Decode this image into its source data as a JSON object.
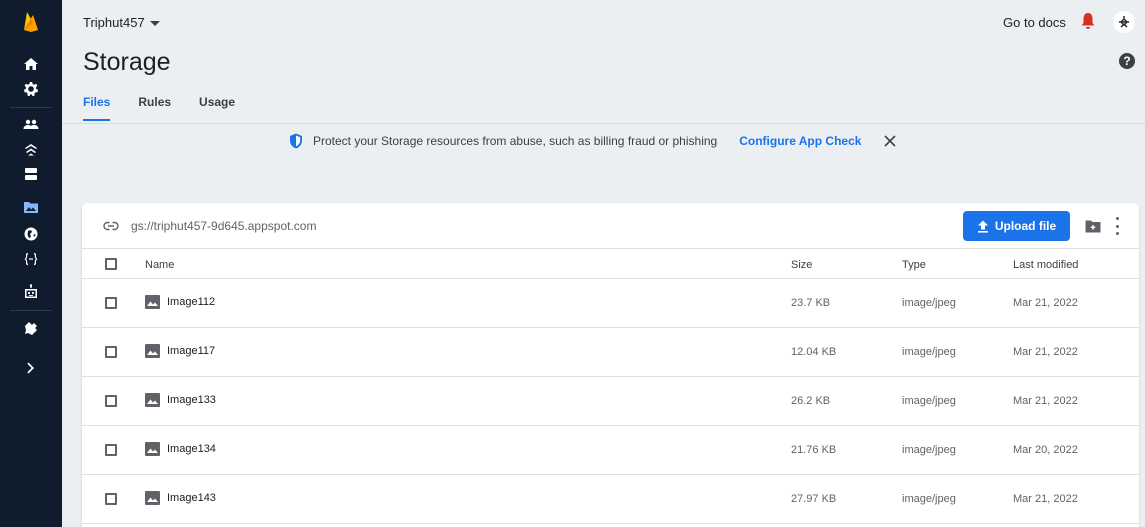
{
  "colors": {
    "rail_bg": "#0f1c2e",
    "accent": "#1a73e8",
    "page_bg": "#eceff1",
    "firebase_orange": "#ffa000",
    "bell_red": "#d93025"
  },
  "rail": {
    "icons": [
      "firebase-logo-icon",
      "home-icon",
      "gear-icon",
      "people-icon",
      "cloud-signal-icon",
      "database-icon",
      "storage-folder-icon",
      "globe-icon",
      "functions-icon",
      "robot-icon",
      "extensions-icon",
      "chevron-right-icon"
    ],
    "active": "storage-folder-icon"
  },
  "topbar": {
    "project_name": "Triphut457",
    "docs_link": "Go to docs"
  },
  "page": {
    "title": "Storage"
  },
  "tabs": [
    {
      "label": "Files",
      "active": true
    },
    {
      "label": "Rules",
      "active": false
    },
    {
      "label": "Usage",
      "active": false
    }
  ],
  "banner": {
    "message": "Protect your Storage resources from abuse, such as billing fraud or phishing",
    "cta": "Configure App Check"
  },
  "bucket": {
    "url": "gs://triphut457-9d645.appspot.com",
    "upload_label": "Upload file"
  },
  "table": {
    "columns": [
      "Name",
      "Size",
      "Type",
      "Last modified"
    ],
    "rows": [
      {
        "name": "Image112",
        "size": "23.7 KB",
        "type": "image/jpeg",
        "modified": "Mar 21, 2022"
      },
      {
        "name": "Image117",
        "size": "12.04 KB",
        "type": "image/jpeg",
        "modified": "Mar 21, 2022"
      },
      {
        "name": "Image133",
        "size": "26.2 KB",
        "type": "image/jpeg",
        "modified": "Mar 21, 2022"
      },
      {
        "name": "Image134",
        "size": "21.76 KB",
        "type": "image/jpeg",
        "modified": "Mar 20, 2022"
      },
      {
        "name": "Image143",
        "size": "27.97 KB",
        "type": "image/jpeg",
        "modified": "Mar 21, 2022"
      }
    ]
  }
}
